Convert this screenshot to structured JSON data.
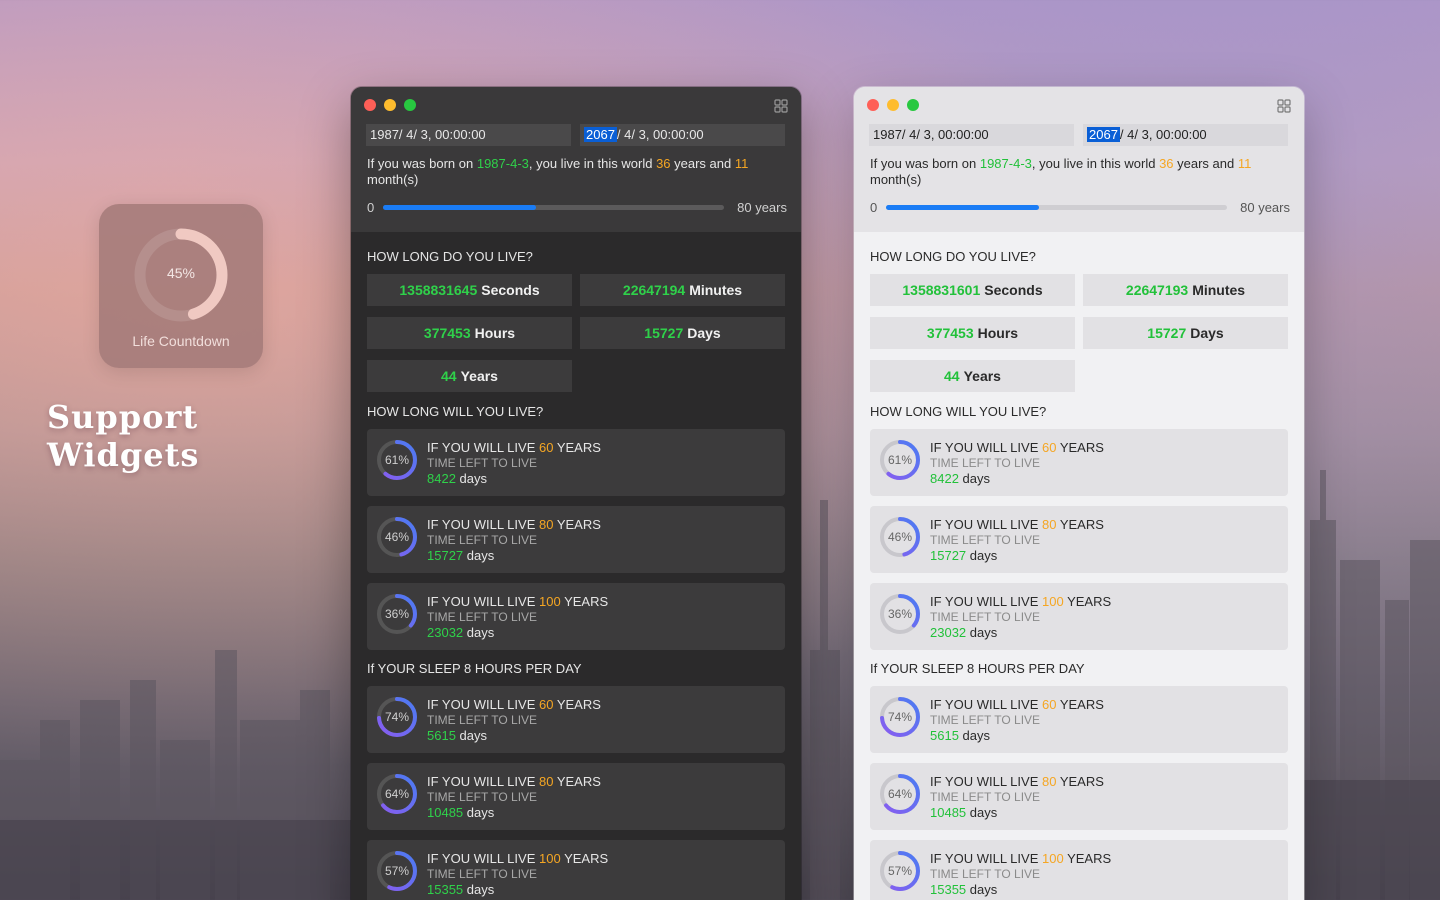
{
  "widget": {
    "percent": "45%",
    "progress": 0.45,
    "label": "Life Countdown"
  },
  "headline": "Support Widgets",
  "colors": {
    "accent_blue": "#1a7cf5",
    "number_green": "#2fd14a",
    "number_orange": "#f5a623",
    "gauge_start": "#8a5cf0",
    "gauge_end": "#4a7cf2"
  },
  "icons": {
    "grid": "grid-icon"
  },
  "windows": [
    {
      "theme": "dark",
      "birth_date": "1987/  4/  3, 00:00:00",
      "end_date_year": "2067",
      "end_date_rest": "/  4/  3, 00:00:00",
      "intro": {
        "prefix": "If you was born on ",
        "date": "1987-4-3",
        "middle": ", you live in this world ",
        "years": "36",
        "years_word": " years and ",
        "months": "11",
        "suffix": " month(s)"
      },
      "progress": {
        "min": "0",
        "max": "80 years",
        "fraction": 0.45
      },
      "how_long_title": "HOW LONG DO YOU LIVE?",
      "stats": [
        {
          "value": "1358831645",
          "unit": "Seconds"
        },
        {
          "value": "22647194",
          "unit": "Minutes"
        },
        {
          "value": "377453",
          "unit": "Hours"
        },
        {
          "value": "15727",
          "unit": "Days"
        },
        {
          "value": "44",
          "unit": "Years"
        }
      ],
      "how_long_will_title": "HOW LONG WILL YOU LIVE?",
      "sleep_title": "If YOUR SLEEP 8 HOURS PER DAY",
      "live_cards": [
        {
          "percent": "61%",
          "fraction": 0.61,
          "prefix": "IF YOU WILL LIVE ",
          "years": "60",
          "suffix": " YEARS",
          "sub": "TIME LEFT TO LIVE",
          "days": "8422",
          "days_word": " days"
        },
        {
          "percent": "46%",
          "fraction": 0.46,
          "prefix": "IF YOU WILL LIVE ",
          "years": "80",
          "suffix": " YEARS",
          "sub": "TIME LEFT TO LIVE",
          "days": "15727",
          "days_word": " days"
        },
        {
          "percent": "36%",
          "fraction": 0.36,
          "prefix": "IF YOU WILL LIVE ",
          "years": "100",
          "suffix": " YEARS",
          "sub": "TIME LEFT TO LIVE",
          "days": "23032",
          "days_word": " days"
        }
      ],
      "sleep_cards": [
        {
          "percent": "74%",
          "fraction": 0.74,
          "prefix": "IF YOU WILL LIVE ",
          "years": "60",
          "suffix": " YEARS",
          "sub": "TIME LEFT TO LIVE",
          "days": "5615",
          "days_word": " days"
        },
        {
          "percent": "64%",
          "fraction": 0.64,
          "prefix": "IF YOU WILL LIVE ",
          "years": "80",
          "suffix": " YEARS",
          "sub": "TIME LEFT TO LIVE",
          "days": "10485",
          "days_word": " days"
        },
        {
          "percent": "57%",
          "fraction": 0.57,
          "prefix": "IF YOU WILL LIVE ",
          "years": "100",
          "suffix": " YEARS",
          "sub": "TIME LEFT TO LIVE",
          "days": "15355",
          "days_word": " days"
        }
      ]
    },
    {
      "theme": "light",
      "birth_date": "1987/  4/  3, 00:00:00",
      "end_date_year": "2067",
      "end_date_rest": "/  4/  3, 00:00:00",
      "intro": {
        "prefix": "If you was born on ",
        "date": "1987-4-3",
        "middle": ", you live in this world ",
        "years": "36",
        "years_word": " years and ",
        "months": "11",
        "suffix": " month(s)"
      },
      "progress": {
        "min": "0",
        "max": "80 years",
        "fraction": 0.45
      },
      "how_long_title": "HOW LONG DO YOU LIVE?",
      "stats": [
        {
          "value": "1358831601",
          "unit": "Seconds"
        },
        {
          "value": "22647193",
          "unit": "Minutes"
        },
        {
          "value": "377453",
          "unit": "Hours"
        },
        {
          "value": "15727",
          "unit": "Days"
        },
        {
          "value": "44",
          "unit": "Years"
        }
      ],
      "how_long_will_title": "HOW LONG WILL YOU LIVE?",
      "sleep_title": "If YOUR SLEEP 8 HOURS PER DAY",
      "live_cards": [
        {
          "percent": "61%",
          "fraction": 0.61,
          "prefix": "IF YOU WILL LIVE ",
          "years": "60",
          "suffix": " YEARS",
          "sub": "TIME LEFT TO LIVE",
          "days": "8422",
          "days_word": " days"
        },
        {
          "percent": "46%",
          "fraction": 0.46,
          "prefix": "IF YOU WILL LIVE ",
          "years": "80",
          "suffix": " YEARS",
          "sub": "TIME LEFT TO LIVE",
          "days": "15727",
          "days_word": " days"
        },
        {
          "percent": "36%",
          "fraction": 0.36,
          "prefix": "IF YOU WILL LIVE ",
          "years": "100",
          "suffix": " YEARS",
          "sub": "TIME LEFT TO LIVE",
          "days": "23032",
          "days_word": " days"
        }
      ],
      "sleep_cards": [
        {
          "percent": "74%",
          "fraction": 0.74,
          "prefix": "IF YOU WILL LIVE ",
          "years": "60",
          "suffix": " YEARS",
          "sub": "TIME LEFT TO LIVE",
          "days": "5615",
          "days_word": " days"
        },
        {
          "percent": "64%",
          "fraction": 0.64,
          "prefix": "IF YOU WILL LIVE ",
          "years": "80",
          "suffix": " YEARS",
          "sub": "TIME LEFT TO LIVE",
          "days": "10485",
          "days_word": " days"
        },
        {
          "percent": "57%",
          "fraction": 0.57,
          "prefix": "IF YOU WILL LIVE ",
          "years": "100",
          "suffix": " YEARS",
          "sub": "TIME LEFT TO LIVE",
          "days": "15355",
          "days_word": " days"
        }
      ]
    }
  ]
}
